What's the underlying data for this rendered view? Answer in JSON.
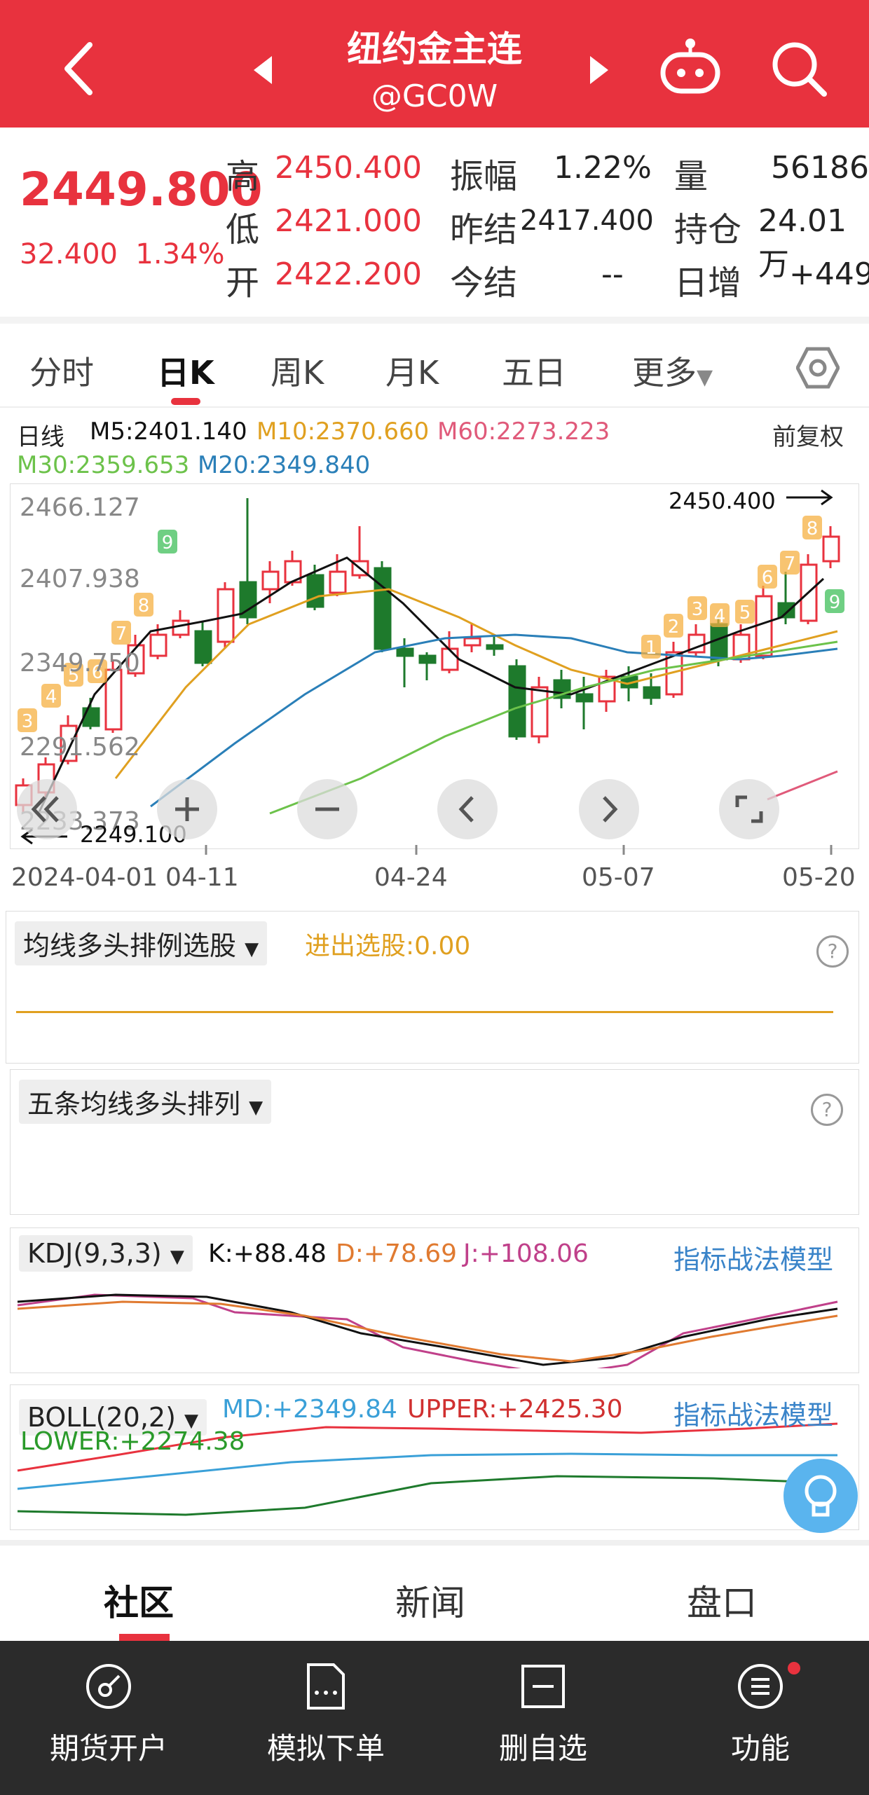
{
  "header": {
    "title": "纽约金主连",
    "code": "@GC0W"
  },
  "quote": {
    "last": "2449.800",
    "change": "32.400",
    "change_pct": "1.34%",
    "high_label": "高",
    "high": "2450.400",
    "low_label": "低",
    "low": "2421.000",
    "open_label": "开",
    "open": "2422.200",
    "amp_label": "振幅",
    "amp": "1.22%",
    "prev_settle_label": "昨结",
    "prev_settle": "2417.400",
    "settle_label": "今结",
    "settle": "--",
    "vol_label": "量",
    "vol": "56186",
    "oi_label": "持仓",
    "oi": "24.01万",
    "daily_inc_label": "日增",
    "daily_inc": "+449"
  },
  "tabs": [
    "分时",
    "日K",
    "周K",
    "月K",
    "五日",
    "更多"
  ],
  "chart": {
    "period_label": "日线",
    "m5": "M5:2401.140",
    "m10": "M10:2370.660",
    "m60": "M60:2273.223",
    "m30": "M30:2359.653",
    "m20": "M20:2349.840",
    "adjust": "前复权",
    "yticks": [
      "2466.127",
      "2407.938",
      "2349.750",
      "2291.562",
      "2233.373"
    ],
    "high_marker": "2450.400",
    "low_marker": "2249.100",
    "xticks": [
      "2024-04-01",
      "04-11",
      "04-24",
      "05-07",
      "05-20"
    ],
    "td_counts": [
      "3",
      "4",
      "5",
      "6",
      "7",
      "8",
      "9",
      "1",
      "2",
      "3",
      "4",
      "5",
      "6",
      "7",
      "8",
      "9"
    ]
  },
  "strategy1": {
    "name": "均线多头排例选股",
    "value": "进出选股:0.00"
  },
  "strategy2": {
    "name": "五条均线多头排列"
  },
  "kdj": {
    "name": "KDJ(9,3,3)",
    "k": "K:+88.48",
    "d": "D:+78.69",
    "j": "J:+108.06",
    "link": "指标战法模型"
  },
  "boll": {
    "name": "BOLL(20,2)",
    "md": "MD:+2349.84",
    "upper": "UPPER:+2425.30",
    "lower": "LOWER:+2274.38",
    "link": "指标战法模型"
  },
  "bottom_tabs": [
    "社区",
    "新闻",
    "盘口"
  ],
  "nav": [
    {
      "label": "期货开户",
      "icon": "compass-icon"
    },
    {
      "label": "模拟下单",
      "icon": "document-icon"
    },
    {
      "label": "删自选",
      "icon": "minus-box-icon"
    },
    {
      "label": "功能",
      "icon": "menu-circle-icon"
    }
  ],
  "colors": {
    "red": "#e8323e",
    "green": "#1e7a2c",
    "m5": "#111111",
    "m10": "#e0a020",
    "m20": "#2a7fb8",
    "m30": "#6cc24a",
    "m60": "#e05a7a"
  }
}
